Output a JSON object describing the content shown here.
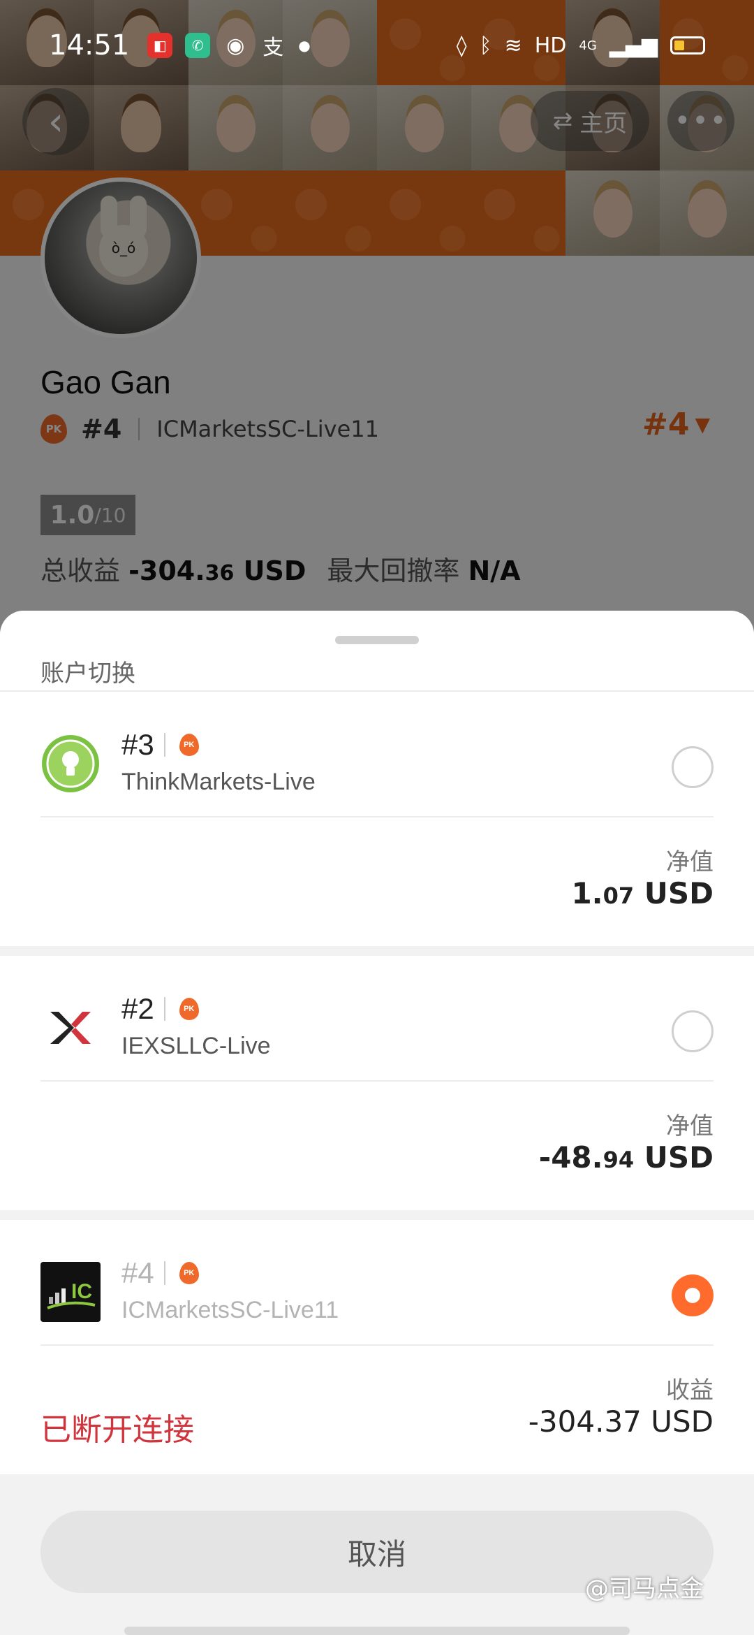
{
  "status_bar": {
    "time": "14:51",
    "network": "HD",
    "signal": "4G"
  },
  "header": {
    "home_label": "主页",
    "more_label": "•••"
  },
  "profile": {
    "name": "Gao Gan",
    "pk_badge": "PK",
    "rank": "#4",
    "server": "ICMarketsSC-Live11",
    "rank_dropdown": "#4",
    "rating": "1.0",
    "rating_max": "/10",
    "total_profit_label": "总收益",
    "total_profit_int": "-304.",
    "total_profit_dec": "36",
    "total_profit_unit": " USD",
    "max_drawdown_label": "最大回撤率",
    "max_drawdown_value": "N/A"
  },
  "sheet": {
    "title": "账户切换",
    "accounts": [
      {
        "rank": "#3",
        "pk_badge": "PK",
        "server": "ThinkMarkets-Live",
        "value_label": "净值",
        "value_int": "1.",
        "value_dec": "07",
        "value_unit": " USD",
        "selected": false
      },
      {
        "rank": "#2",
        "pk_badge": "PK",
        "server": "IEXSLLC-Live",
        "value_label": "净值",
        "value_int": "-48.",
        "value_dec": "94",
        "value_unit": " USD",
        "selected": false
      },
      {
        "rank": "#4",
        "pk_badge": "PK",
        "server": "ICMarketsSC-Live11",
        "logo_text": "IC",
        "value_label": "收益",
        "value": "-304.37 USD",
        "status": "已断开连接",
        "selected": true
      }
    ],
    "cancel_label": "取消"
  },
  "watermark": "@司马点金",
  "colors": {
    "accent": "#ff6b2c",
    "error": "#d0343c",
    "cover_orange": "#e56b1f"
  }
}
